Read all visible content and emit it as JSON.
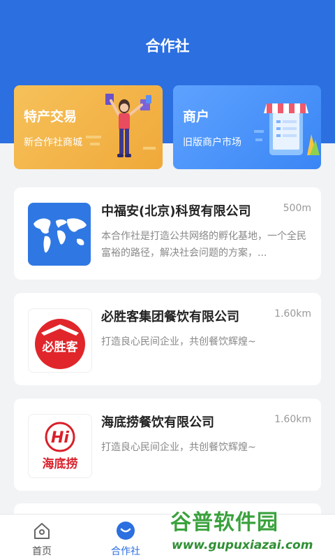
{
  "header": {
    "title": "合作社"
  },
  "banners": [
    {
      "title": "特产交易",
      "subtitle": "新合作社商城",
      "icon": "shopping-woman-illustration",
      "color": "#f3b84c"
    },
    {
      "title": "商户",
      "subtitle": "旧版商户市场",
      "icon": "storefront-phone-illustration",
      "color": "#4a94fb"
    }
  ],
  "cooperatives": [
    {
      "name": "中福安(北京)科贸有限公司",
      "distance": "500m",
      "description": "本合作社是打造公共网络的孵化基地，一个全民富裕的路径，解决社会问题的方案，...",
      "logo": "world-map-logo"
    },
    {
      "name": "必胜客集团餐饮有限公司",
      "distance": "1.60km",
      "description": "打造良心民间企业，共创餐饮辉煌~",
      "logo": "pizza-hut-logo",
      "logo_text": "必胜客"
    },
    {
      "name": "海底捞餐饮有限公司",
      "distance": "1.60km",
      "description": "打造良心民间企业，共创餐饮辉煌~",
      "logo": "haidilao-logo",
      "logo_text": "海底捞",
      "logo_mark": "Hi"
    }
  ],
  "tabbar": [
    {
      "label": "首页",
      "icon": "home-icon",
      "active": false
    },
    {
      "label": "合作社",
      "icon": "cooperative-icon",
      "active": true
    }
  ],
  "watermark": {
    "text": "谷普软件园",
    "url": "www.gupuxiazai.com"
  },
  "colors": {
    "primary": "#2b6fe0",
    "background": "#f2f3f5"
  }
}
